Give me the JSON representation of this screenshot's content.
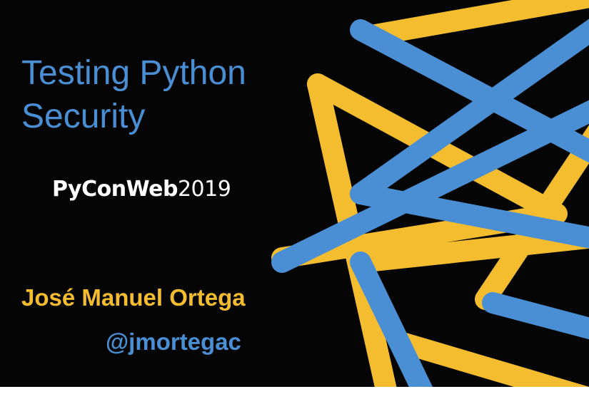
{
  "slide": {
    "title_line1": "Testing Python",
    "title_line2": "Security",
    "conference_name": "PyConWeb",
    "conference_year": "2019",
    "author": "José Manuel Ortega",
    "handle": "@jmortegac"
  },
  "colors": {
    "background": "#050505",
    "blue": "#4a8ed4",
    "yellow": "#f4bd30",
    "white": "#ffffff"
  }
}
